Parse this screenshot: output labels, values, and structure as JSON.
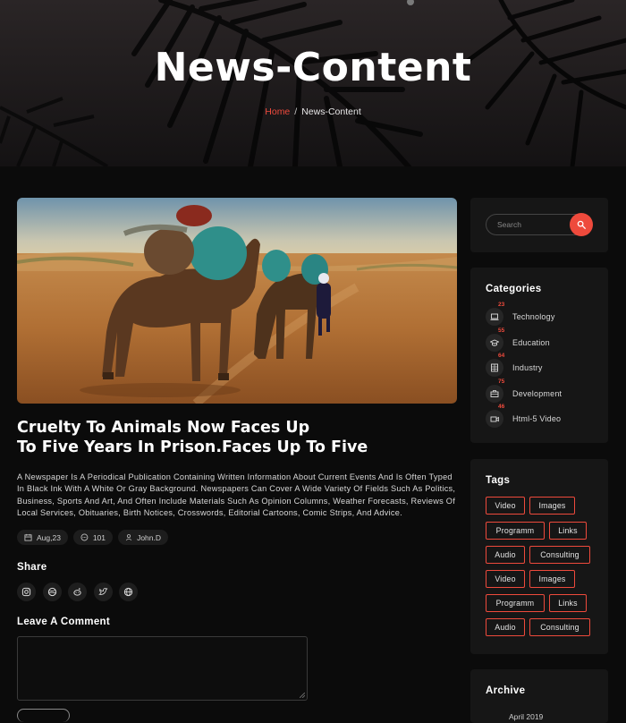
{
  "hero": {
    "title": "News-Content",
    "breadcrumb_home": "Home",
    "breadcrumb_separator": "/",
    "breadcrumb_current": "News-Content"
  },
  "article": {
    "title_line1": "Cruelty To Animals Now Faces Up",
    "title_line2": "To Five Years In Prison.Faces Up To Five",
    "body": "A Newspaper Is A Periodical Publication Containing Written Information About Current Events And Is Often Typed In Black Ink With A White Or Gray Background. Newspapers Can Cover A Wide Variety Of Fields Such As Politics, Business, Sports And Art, And Often Include Materials Such As Opinion Columns, Weather Forecasts, Reviews Of Local Services, Obituaries, Birth Notices, Crosswords, Editorial Cartoons, Comic Strips, And Advice.",
    "meta": {
      "date": "Aug,23",
      "comments": "101",
      "author": "John.D"
    }
  },
  "share": {
    "heading": "Share",
    "icons": [
      "instagram-icon",
      "dribbble-icon",
      "reddit-icon",
      "twitter-icon",
      "globe-icon"
    ]
  },
  "comment": {
    "heading": "Leave A Comment"
  },
  "sidebar": {
    "search_placeholder": "Search",
    "categories_heading": "Categories",
    "categories": [
      {
        "count": "23",
        "label": "Technology",
        "icon": "laptop-icon"
      },
      {
        "count": "55",
        "label": "Education",
        "icon": "graduation-cap-icon"
      },
      {
        "count": "64",
        "label": "Industry",
        "icon": "building-icon"
      },
      {
        "count": "75",
        "label": "Development",
        "icon": "briefcase-icon"
      },
      {
        "count": "46",
        "label": "Html-5 Video",
        "icon": "video-icon"
      }
    ],
    "tags_heading": "Tags",
    "tags": [
      "Video",
      "Images",
      "Programm",
      "Links",
      "Audio",
      "Consulting",
      "Video",
      "Images",
      "Programm",
      "Links",
      "Audio",
      "Consulting"
    ],
    "archive_heading": "Archive",
    "archive_first": "April 2019"
  },
  "colors": {
    "accent": "#ee4a3c",
    "background": "#0b0b0b",
    "card": "#161616"
  }
}
